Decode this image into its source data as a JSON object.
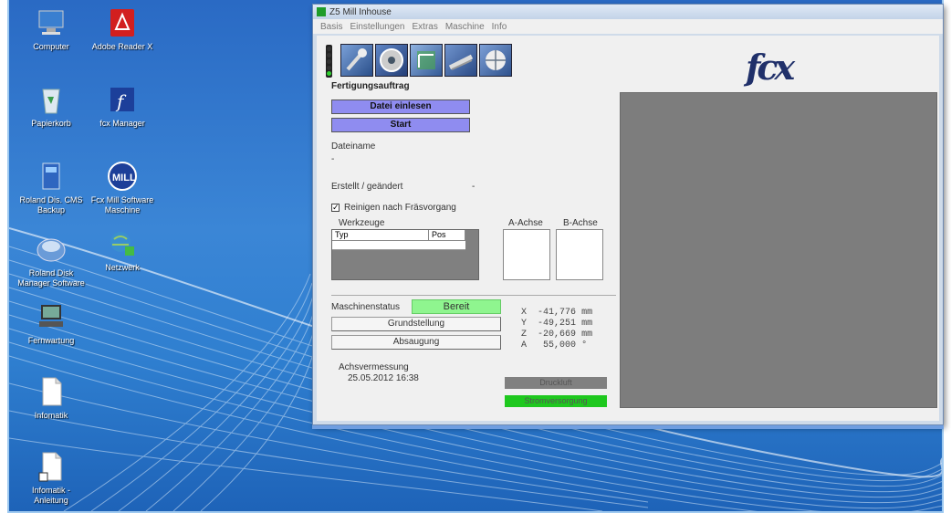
{
  "desktop": {
    "icons": [
      {
        "label": "Computer",
        "name": "computer-icon"
      },
      {
        "label": "Adobe Reader X",
        "name": "adobe-reader-icon"
      },
      {
        "label": "Papierkorb",
        "name": "recycle-bin-icon"
      },
      {
        "label": "fcx Manager",
        "name": "fcx-manager-icon"
      },
      {
        "label": "Roland Dis. CMS Backup",
        "name": "roland-backup-icon"
      },
      {
        "label": "Fcx Mill Software Maschine",
        "name": "mill-software-icon"
      },
      {
        "label": "Roland Disk Manager Software",
        "name": "roland-disk-icon"
      },
      {
        "label": "Netzwerk",
        "name": "network-icon"
      },
      {
        "label": "Fernwartung",
        "name": "remote-icon"
      },
      {
        "label": "Infomatik",
        "name": "info-doc-icon"
      },
      {
        "label": "Infomatik - Anleitung",
        "name": "info-doc2-icon"
      }
    ]
  },
  "app": {
    "title": "Z5 Mill Inhouse",
    "menu": [
      "Basis",
      "Einstellungen",
      "Extras",
      "Maschine",
      "Info"
    ],
    "toolbar": [
      "milling-tool-icon",
      "disc-icon",
      "calibration-icon",
      "mill-head-icon",
      "globe-icon"
    ],
    "logo": "fcx",
    "job_title": "Fertigungsauftrag",
    "load_button": "Datei einlesen",
    "start_button": "Start",
    "filename_label": "Dateiname",
    "filename_value": "-",
    "created_label": "Erstellt / geändert",
    "created_value": "-",
    "clean_checkbox_label": "Reinigen nach Fräsvorgang",
    "clean_checked": "✓",
    "tools_label": "Werkzeuge",
    "tools_columns": [
      "Typ",
      "Pos"
    ],
    "a_axis_label": "A-Achse",
    "b_axis_label": "B-Achse",
    "machine_status_label": "Maschinenstatus",
    "machine_status_value": "Bereit",
    "home_button": "Grundstellung",
    "suction_button": "Absaugung",
    "coords": [
      {
        "axis": "X",
        "value": "-41,776",
        "unit": "mm"
      },
      {
        "axis": "Y",
        "value": "-49,251",
        "unit": "mm"
      },
      {
        "axis": "Z",
        "value": "-20,669",
        "unit": "mm"
      },
      {
        "axis": "A",
        "value": "55,000",
        "unit": "°"
      }
    ],
    "calibration_label": "Achsvermessung",
    "calibration_date": "25.05.2012 16:38",
    "status_indicator_1": "Druckluft",
    "status_indicator_2": "Stromversorgung",
    "colors": {
      "ready": "#8ff58f",
      "button": "#8f8cf0",
      "indicator_grey": "#808080",
      "indicator_green": "#1ec81e"
    }
  }
}
